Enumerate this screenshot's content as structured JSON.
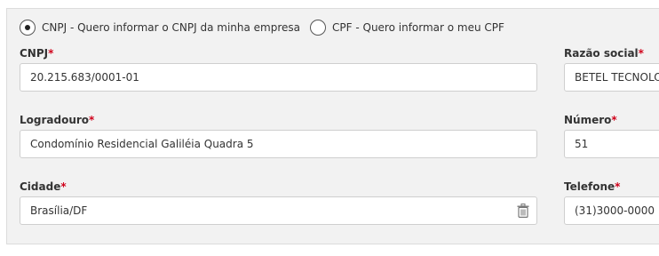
{
  "doc_type": {
    "options": [
      {
        "label": "CNPJ - Quero informar o CNPJ da minha empresa",
        "checked": true
      },
      {
        "label": "CPF - Quero informar o meu CPF",
        "checked": false
      }
    ]
  },
  "fields": {
    "cnpj": {
      "label": "CNPJ",
      "required": "*",
      "value": "20.215.683/0001-01"
    },
    "razao_social": {
      "label": "Razão social",
      "required": "*",
      "value": "BETEL TECNOLOGIA"
    },
    "logradouro": {
      "label": "Logradouro",
      "required": "*",
      "value": "Condomínio Residencial Galiléia Quadra 5"
    },
    "numero": {
      "label": "Número",
      "required": "*",
      "value": "51"
    },
    "cidade": {
      "label": "Cidade",
      "required": "*",
      "value": "Brasília/DF"
    },
    "telefone": {
      "label": "Telefone",
      "required": "*",
      "value": "(31)3000-0000"
    }
  },
  "icons": {
    "clear": "trash-icon"
  },
  "colors": {
    "required": "#d0021b",
    "panel_bg": "#f2f2f2",
    "input_border": "#cfcfcf"
  }
}
